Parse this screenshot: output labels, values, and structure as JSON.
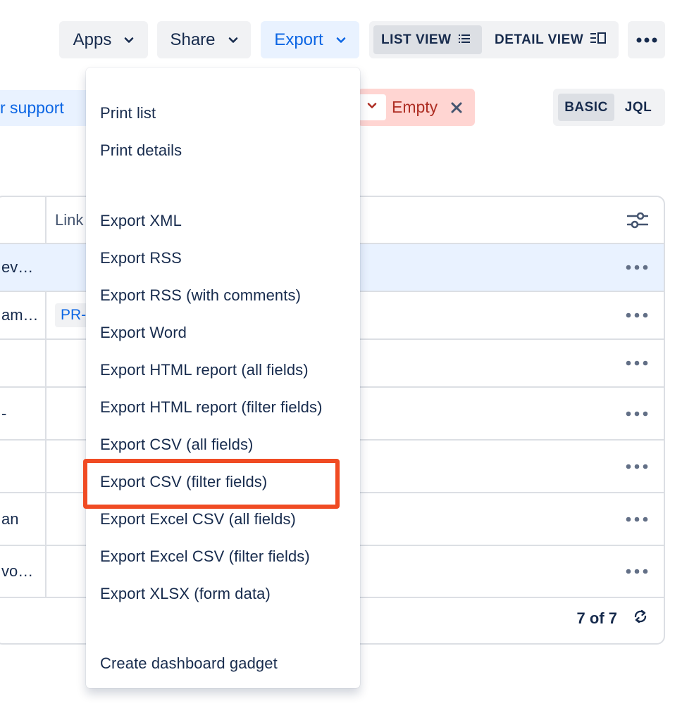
{
  "toolbar": {
    "apps_label": "Apps",
    "share_label": "Share",
    "export_label": "Export",
    "list_view_label": "LIST VIEW",
    "detail_view_label": "DETAIL VIEW"
  },
  "filters": {
    "chip_left_label": "r support",
    "empty_chip_label": "Empty",
    "basic_label": "BASIC",
    "jql_label": "JQL"
  },
  "table": {
    "header_link": "Link",
    "rows": [
      {
        "text": "ev…"
      },
      {
        "text": "am…",
        "tag": "PR-"
      },
      {
        "text": ""
      },
      {
        "text": "-"
      },
      {
        "text": ""
      },
      {
        "text": "an"
      },
      {
        "text": "vo…"
      }
    ],
    "count_label": "7 of 7"
  },
  "export_menu": {
    "items": [
      "Print list",
      "Print details",
      "Export XML",
      "Export RSS",
      "Export RSS (with comments)",
      "Export Word",
      "Export HTML report (all fields)",
      "Export HTML report (filter fields)",
      "Export CSV (all fields)",
      "Export CSV (filter fields)",
      "Export Excel CSV (all fields)",
      "Export Excel CSV (filter fields)",
      "Export XLSX (form data)",
      "Create dashboard gadget"
    ],
    "highlighted_item": "Export CSV (filter fields)"
  },
  "colors": {
    "accent_blue": "#0c66e4",
    "highlight_red": "#f04b23",
    "empty_chip_bg": "#ffd5d2"
  }
}
